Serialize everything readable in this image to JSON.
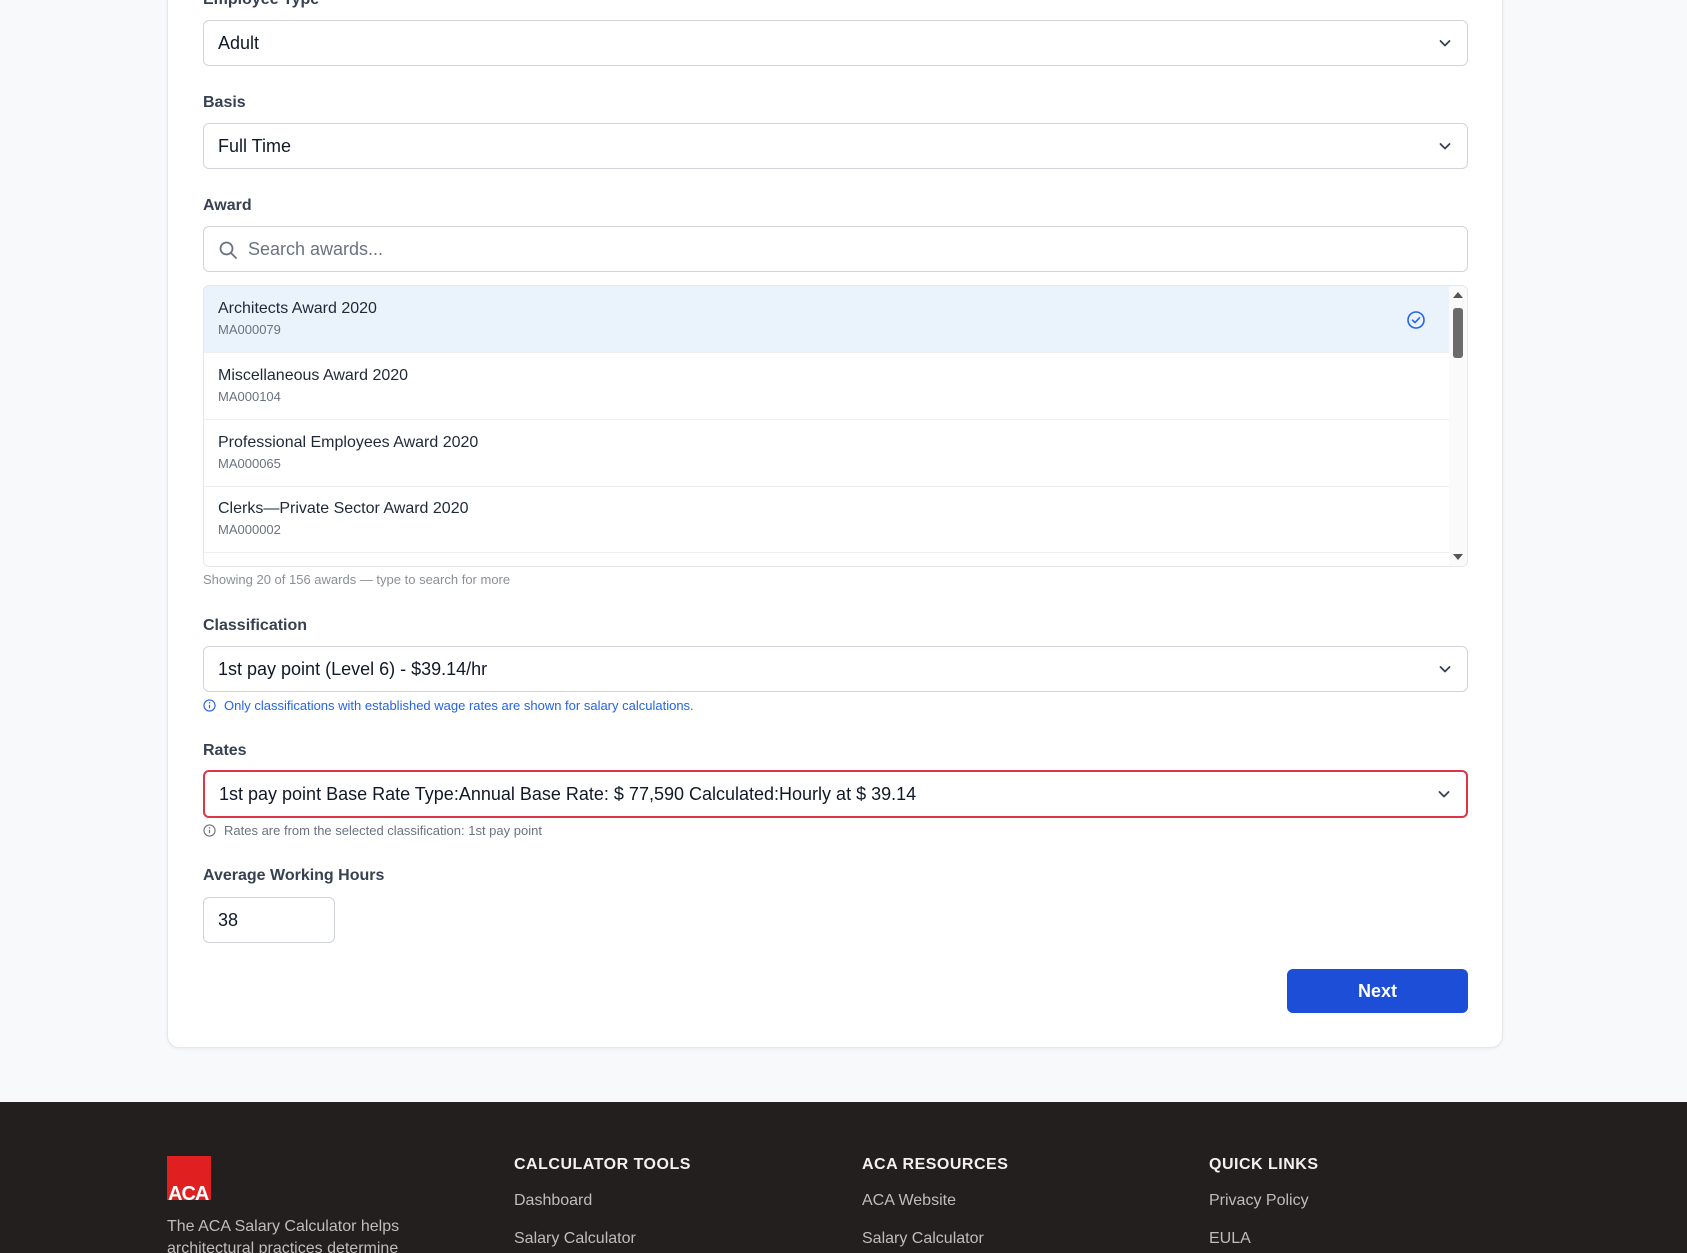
{
  "form": {
    "employee_type": {
      "label": "Employee Type",
      "value": "Adult"
    },
    "basis": {
      "label": "Basis",
      "value": "Full Time"
    },
    "award": {
      "label": "Award",
      "search_placeholder": "Search awards...",
      "items": [
        {
          "name": "Architects Award 2020",
          "code": "MA000079",
          "selected": true
        },
        {
          "name": "Miscellaneous Award 2020",
          "code": "MA000104",
          "selected": false
        },
        {
          "name": "Professional Employees Award 2020",
          "code": "MA000065",
          "selected": false
        },
        {
          "name": "Clerks—Private Sector Award 2020",
          "code": "MA000002",
          "selected": false
        }
      ],
      "hint": "Showing 20 of 156 awards — type to search for more"
    },
    "classification": {
      "label": "Classification",
      "value": "1st pay point (Level 6) - $39.14/hr",
      "info": "Only classifications with established wage rates are shown for salary calculations."
    },
    "rates": {
      "label": "Rates",
      "value": "1st pay point Base Rate Type:Annual Base Rate: $ 77,590 Calculated:Hourly at $ 39.14",
      "info": "Rates are from the selected classification: 1st pay point"
    },
    "hours": {
      "label": "Average Working Hours",
      "value": "38"
    },
    "next_label": "Next"
  },
  "footer": {
    "logo_text": "ACA",
    "description": "The ACA Salary Calculator helps architectural practices determine",
    "columns": [
      {
        "title": "CALCULATOR TOOLS",
        "links": [
          "Dashboard",
          "Salary Calculator"
        ]
      },
      {
        "title": "ACA RESOURCES",
        "links": [
          "ACA Website",
          "Salary Calculator"
        ]
      },
      {
        "title": "QUICK LINKS",
        "links": [
          "Privacy Policy",
          "EULA"
        ]
      }
    ]
  },
  "colors": {
    "primary": "#1d4ed8",
    "error": "#dc3545",
    "footer_bg": "#231f1e",
    "selected_bg": "#eaf2fb"
  }
}
